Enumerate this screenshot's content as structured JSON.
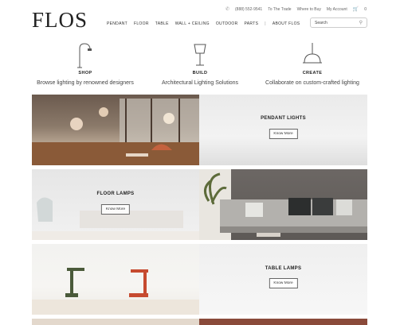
{
  "brand": {
    "logo": "FLOS"
  },
  "utility": {
    "phone": "(888) 552-9541",
    "trade": "To The Trade",
    "where_to_buy": "Where to Buy",
    "account": "My Account",
    "cart_count": "0"
  },
  "nav": {
    "items": [
      "PENDANT",
      "FLOOR",
      "TABLE",
      "WALL + CEILING",
      "OUTDOOR",
      "PARTS"
    ],
    "separator": "|",
    "about": "ABOUT FLOS"
  },
  "search": {
    "placeholder": "Search"
  },
  "categories": [
    {
      "title": "SHOP",
      "subtitle": "Browse lighting by renowned designers",
      "icon": "floor-lamp-icon"
    },
    {
      "title": "BUILD",
      "subtitle": "Architectural Lighting Solutions",
      "icon": "table-lamp-icon"
    },
    {
      "title": "CREATE",
      "subtitle": "Collaborate on custom-crafted lighting",
      "icon": "pendant-lamp-icon"
    }
  ],
  "tiles": {
    "pendant": {
      "title": "PENDANT LIGHTS",
      "button": "Know More"
    },
    "floor": {
      "title": "FLOOR LAMPS",
      "button": "Know More"
    },
    "table": {
      "title": "TABLE LAMPS",
      "button": "Know More"
    }
  },
  "colors": {
    "text": "#222222",
    "accent_red": "#c64a2f",
    "accent_green": "#4a5a3a"
  }
}
